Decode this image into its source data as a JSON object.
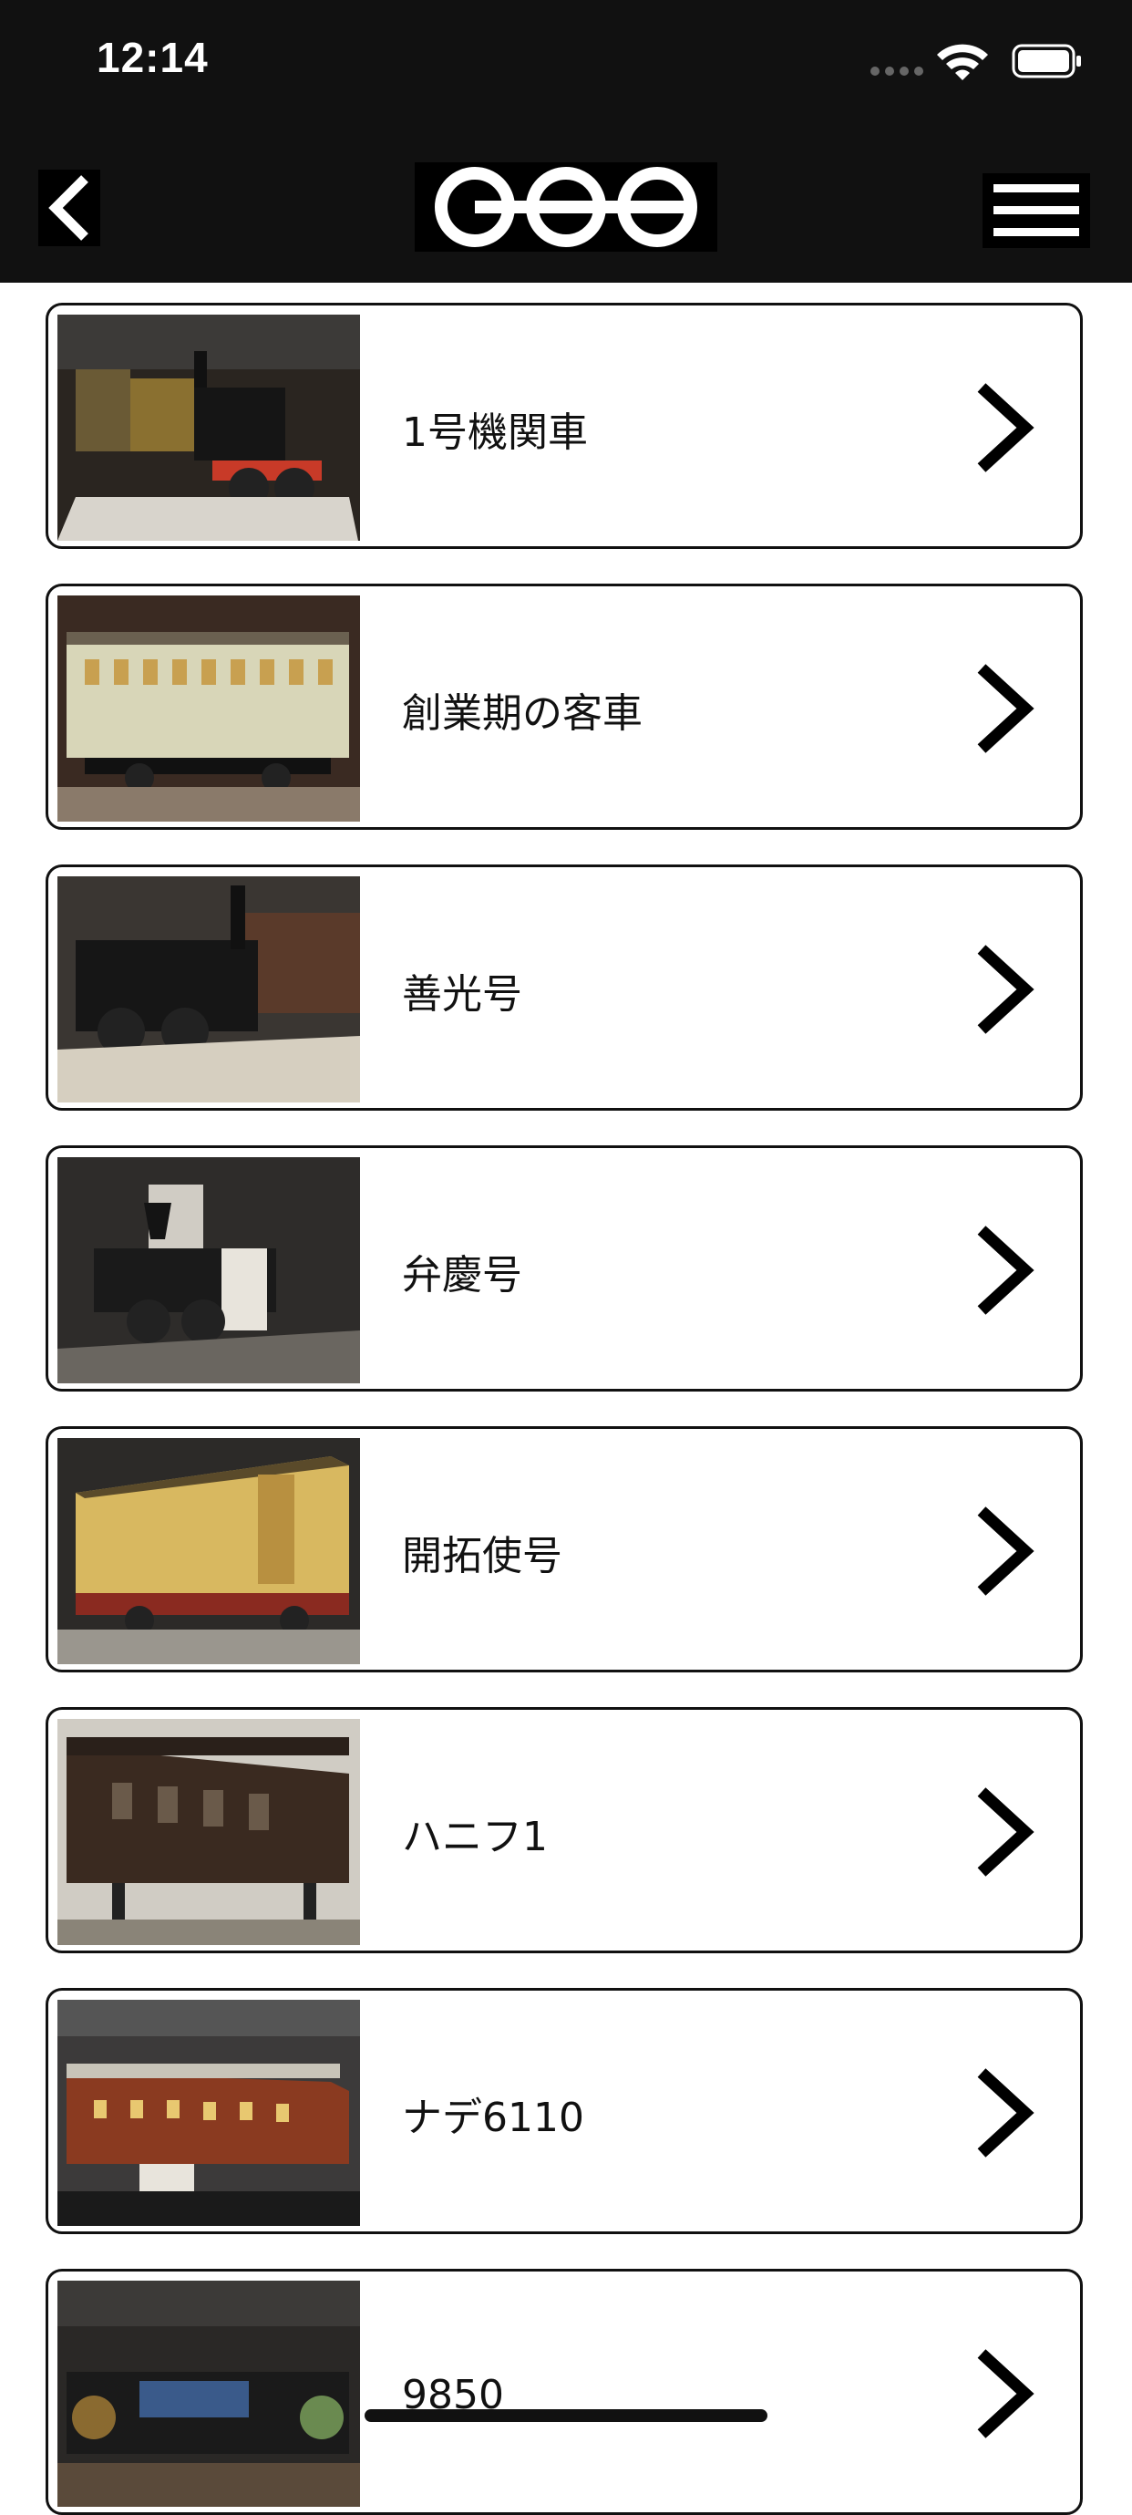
{
  "status_bar": {
    "time": "12:14"
  },
  "header": {
    "logo": "logo"
  },
  "items": [
    {
      "label": "1号機関車",
      "thumb": "locomotive-1"
    },
    {
      "label": "創業期の客車",
      "thumb": "early-passenger-car"
    },
    {
      "label": "善光号",
      "thumb": "zenko-locomotive"
    },
    {
      "label": "弁慶号",
      "thumb": "benkei-locomotive"
    },
    {
      "label": "開拓使号",
      "thumb": "kaitakushi-car"
    },
    {
      "label": "ハニフ1",
      "thumb": "hanifu1-car"
    },
    {
      "label": "ナデ6110",
      "thumb": "nade6110-car"
    },
    {
      "label": "9850",
      "thumb": "locomotive-9850"
    }
  ],
  "colors": {
    "bar": "#111111",
    "border": "#111111",
    "background": "#ffffff"
  }
}
